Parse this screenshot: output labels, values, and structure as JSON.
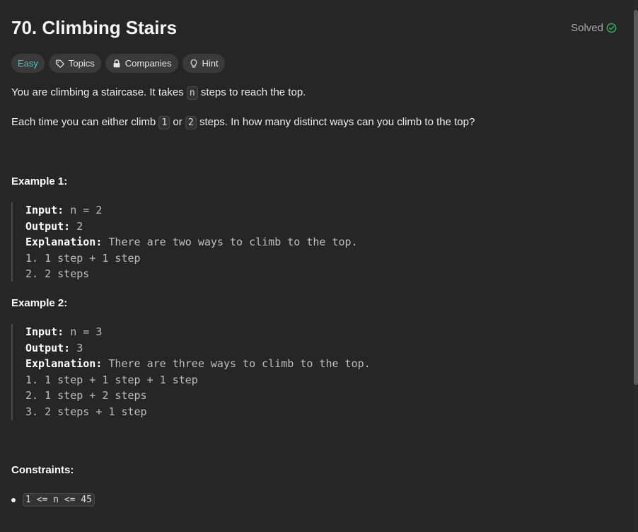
{
  "problem": {
    "title": "70. Climbing Stairs",
    "status": "Solved"
  },
  "tags": {
    "difficulty": "Easy",
    "topics": "Topics",
    "companies": "Companies",
    "hint": "Hint"
  },
  "description": {
    "p1_before": "You are climbing a staircase. It takes ",
    "p1_code": "n",
    "p1_after": " steps to reach the top.",
    "p2_before": "Each time you can either climb ",
    "p2_code1": "1",
    "p2_mid": " or ",
    "p2_code2": "2",
    "p2_after": " steps. In how many distinct ways can you climb to the top?"
  },
  "example1": {
    "heading": "Example 1:",
    "input_label": "Input:",
    "input_value": " n = 2",
    "output_label": "Output:",
    "output_value": " 2",
    "explanation_label": "Explanation:",
    "explanation_value": " There are two ways to climb to the top.",
    "lines": [
      "1. 1 step + 1 step",
      "2. 2 steps"
    ]
  },
  "example2": {
    "heading": "Example 2:",
    "input_label": "Input:",
    "input_value": " n = 3",
    "output_label": "Output:",
    "output_value": " 3",
    "explanation_label": "Explanation:",
    "explanation_value": " There are three ways to climb to the top.",
    "lines": [
      "1. 1 step + 1 step + 1 step",
      "2. 1 step + 2 steps",
      "3. 2 steps + 1 step"
    ]
  },
  "constraints": {
    "heading": "Constraints:",
    "items": [
      "1 <= n <= 45"
    ]
  },
  "icons": {
    "solved": "check-circle-icon",
    "topics": "tag-icon",
    "companies": "lock-icon",
    "hint": "lightbulb-icon"
  },
  "colors": {
    "easy": "#46c6c2",
    "solved_check": "#2cbb5d",
    "background": "#262626"
  }
}
